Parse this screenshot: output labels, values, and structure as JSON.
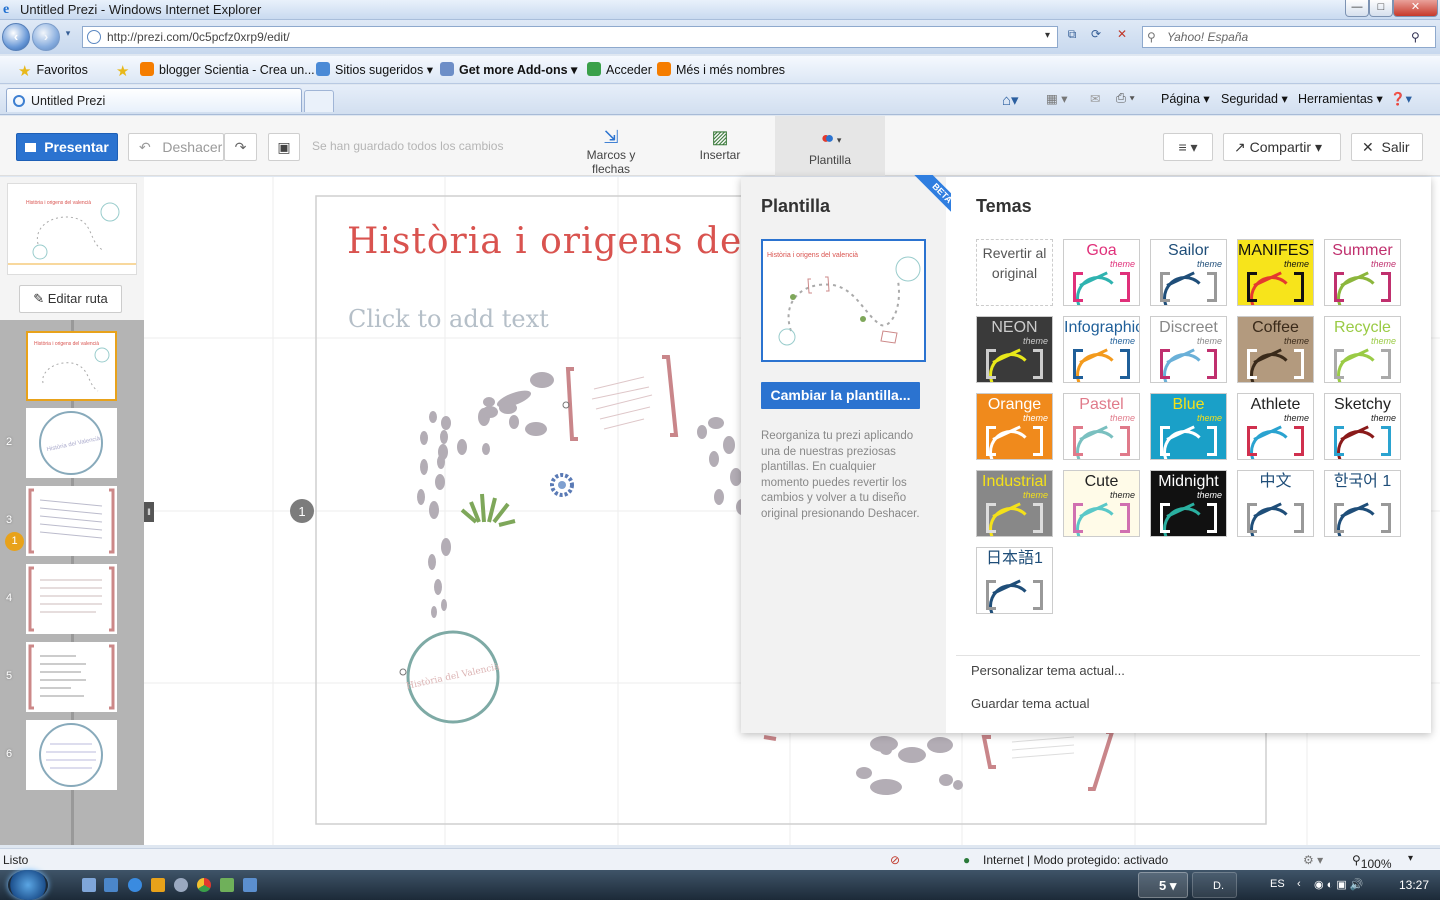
{
  "window": {
    "title": "Untitled Prezi - Windows Internet Explorer",
    "address": "http://prezi.com/0c5pcfz0xrp9/edit/",
    "search_placeholder": "Yahoo! España",
    "minimize": "—",
    "maximize": "□",
    "close": "✕"
  },
  "favorites": {
    "label": "Favoritos",
    "items": [
      "blogger Scientia - Crea un...",
      "Sitios sugeridos ▾",
      "Get more Add-ons ▾",
      "Acceder",
      "Més i més nombres"
    ]
  },
  "tabs": {
    "active": "Untitled Prezi",
    "commands": [
      "Página ▾",
      "Seguridad ▾",
      "Herramientas ▾"
    ]
  },
  "toolbar": {
    "present": "Presentar",
    "undo": "Deshacer",
    "saved_status": "Se han guardado todos los cambios",
    "frames": "Marcos y flechas",
    "insert": "Insertar",
    "template": "Plantilla",
    "share": "Compartir",
    "exit": "Salir"
  },
  "sidebar": {
    "edit_path": "Editar ruta",
    "steps": [
      "1",
      "2",
      "3",
      "4",
      "5",
      "6"
    ]
  },
  "canvas": {
    "title": "Història i origens de",
    "subtitle": "Click to add text",
    "step_marker": "1",
    "circle_label": "Història del Valencià"
  },
  "template_panel": {
    "title": "Plantilla",
    "beta": "BETA",
    "change_button": "Cambiar la plantilla...",
    "description": "Reorganiza tu prezi aplicando una de nuestras preziosas plantillas. En cualquier momento puedes revertir los cambios y volver a tu diseño original presionando Deshacer.",
    "thumb_title": "Història i origens del valencià"
  },
  "themes": {
    "title": "Temas",
    "revert": "Revertir al original",
    "subtitle_word": "theme",
    "items": [
      {
        "name": "Goa",
        "bg": "#ffffff",
        "fg": "#e0307a",
        "c2": "#2fb3b0",
        "c3": "#e0307a"
      },
      {
        "name": "Sailor",
        "bg": "#ffffff",
        "fg": "#1f4e79",
        "c2": "#1f4e79",
        "c3": "#999999"
      },
      {
        "name": "MANIFESTO",
        "bg": "#f7e41b",
        "fg": "#111111",
        "c2": "#e43a2f",
        "c3": "#111111"
      },
      {
        "name": "Summer",
        "bg": "#ffffff",
        "fg": "#c0306e",
        "c2": "#8cb63c",
        "c3": "#c0306e"
      },
      {
        "name": "NEON",
        "bg": "#3a3a3a",
        "fg": "#cccccc",
        "c2": "#e8e81a",
        "c3": "#cccccc"
      },
      {
        "name": "Infographic",
        "bg": "#ffffff",
        "fg": "#1f5f99",
        "c2": "#f39a1d",
        "c3": "#1f5f99"
      },
      {
        "name": "Discreet",
        "bg": "#ffffff",
        "fg": "#888888",
        "c2": "#6ab0d8",
        "c3": "#c0306e"
      },
      {
        "name": "Coffee",
        "bg": "#b39a7e",
        "fg": "#3a2a1a",
        "c2": "#3a2a1a",
        "c3": "#ffffff"
      },
      {
        "name": "Recycle",
        "bg": "#ffffff",
        "fg": "#9acb45",
        "c2": "#9acb45",
        "c3": "#aaaaaa"
      },
      {
        "name": "Orange",
        "bg": "#f08a1c",
        "fg": "#ffffff",
        "c2": "#ffffff",
        "c3": "#ffffff"
      },
      {
        "name": "Pastel",
        "bg": "#ffffff",
        "fg": "#e07a8a",
        "c2": "#7ac0c0",
        "c3": "#e07a8a"
      },
      {
        "name": "Blue",
        "bg": "#1aa0c8",
        "fg": "#f4e11a",
        "c2": "#ffffff",
        "c3": "#ffffff"
      },
      {
        "name": "Athlete",
        "bg": "#ffffff",
        "fg": "#222222",
        "c2": "#2aa3d0",
        "c3": "#d0304e"
      },
      {
        "name": "Sketchy",
        "bg": "#ffffff",
        "fg": "#222222",
        "c2": "#8a1a1a",
        "c3": "#2aa3d0"
      },
      {
        "name": "Industrial",
        "bg": "#888888",
        "fg": "#f4e11a",
        "c2": "#f4e11a",
        "c3": "#dddddd"
      },
      {
        "name": "Cute",
        "bg": "#fffbe8",
        "fg": "#222222",
        "c2": "#5ac8c8",
        "c3": "#d070b0"
      },
      {
        "name": "Midnight",
        "bg": "#111111",
        "fg": "#ffffff",
        "c2": "#2ab0a0",
        "c3": "#ffffff"
      },
      {
        "name": "中文",
        "bg": "#ffffff",
        "fg": "#1f4e79",
        "c2": "#1f4e79",
        "c3": "#999999"
      },
      {
        "name": "한국어 1",
        "bg": "#ffffff",
        "fg": "#1f4e79",
        "c2": "#1f4e79",
        "c3": "#999999"
      },
      {
        "name": "日本語1",
        "bg": "#ffffff",
        "fg": "#1f4e79",
        "c2": "#1f4e79",
        "c3": "#999999"
      }
    ],
    "customize": "Personalizar tema actual...",
    "save": "Guardar tema actual"
  },
  "statusbar": {
    "left": "Listo",
    "zone": "Internet | Modo protegido: activado",
    "zoom": "100%"
  },
  "taskbar": {
    "lang": "ES",
    "time": "13:27",
    "ie_count": "5",
    "app2": "D."
  },
  "colors": {
    "accent": "#2b73d0",
    "title_red": "#d9534f",
    "step_orange": "#e8a21a"
  }
}
